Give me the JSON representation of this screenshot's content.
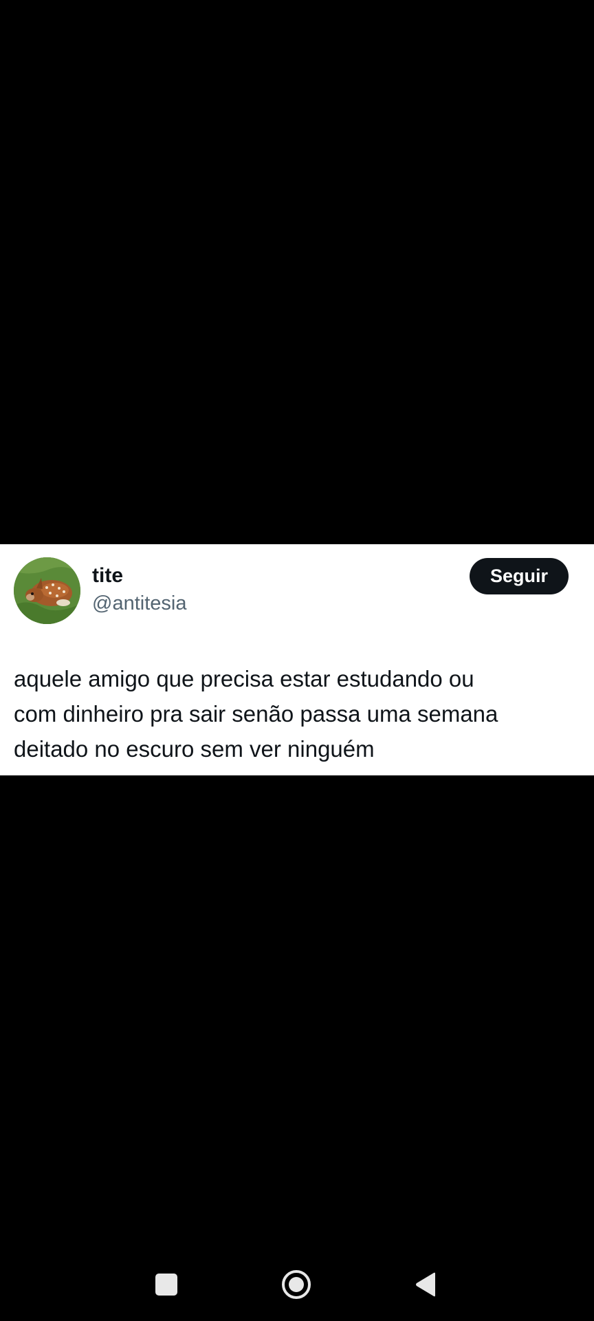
{
  "tweet": {
    "display_name": "tite",
    "handle": "@antitesia",
    "follow_label": "Seguir",
    "text": "aquele amigo que precisa estar estudando ou\ncom dinheiro pra sair senão passa uma semana\ndeitado no escuro sem ver ninguém",
    "avatar_icon": "fawn-avatar"
  },
  "nav_bar": {
    "icons": [
      "recents-icon",
      "home-icon",
      "back-icon"
    ]
  },
  "colors": {
    "background": "#000000",
    "card": "#ffffff",
    "text_primary": "#0f1419",
    "text_secondary": "#536471",
    "button_bg": "#0f1419",
    "nav_icons": "#e8e8e8"
  }
}
